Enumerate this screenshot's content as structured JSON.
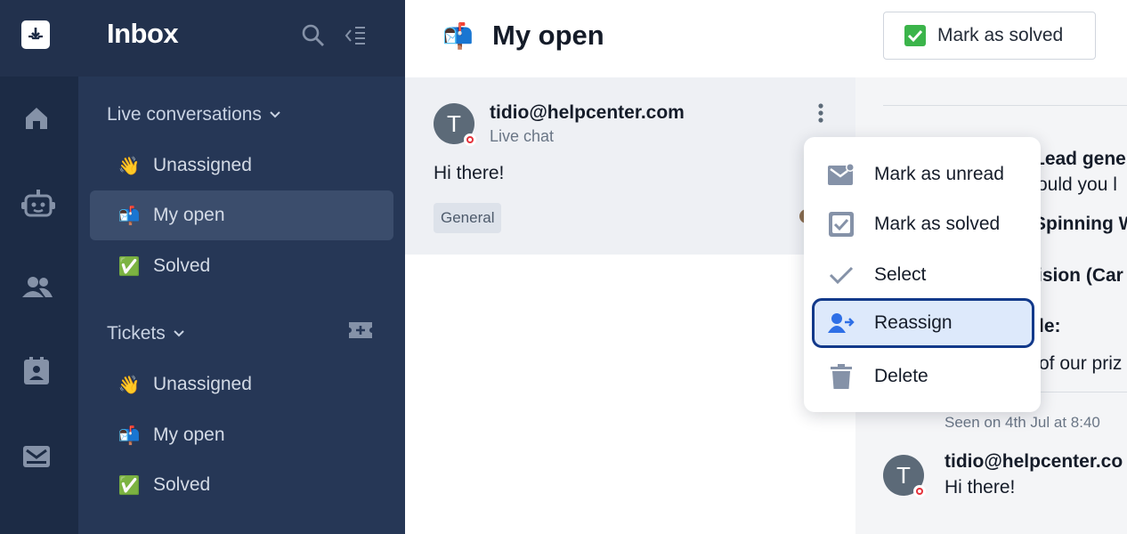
{
  "sidebar": {
    "title": "Inbox",
    "live_section": {
      "label": "Live conversations"
    },
    "live_items": [
      {
        "emoji": "👋",
        "label": "Unassigned"
      },
      {
        "emoji": "📬",
        "label": "My open"
      },
      {
        "emoji": "✅",
        "label": "Solved"
      }
    ],
    "tickets_section": {
      "label": "Tickets"
    },
    "ticket_items": [
      {
        "emoji": "👋",
        "label": "Unassigned"
      },
      {
        "emoji": "📬",
        "label": "My open"
      },
      {
        "emoji": "✅",
        "label": "Solved"
      }
    ]
  },
  "list": {
    "emoji": "📬",
    "title": "My open",
    "conversation": {
      "avatar_letter": "T",
      "email": "tidio@helpcenter.com",
      "channel": "Live chat",
      "preview": "Hi there!",
      "tag": "General"
    }
  },
  "menu": {
    "items": [
      {
        "icon": "mail-unread-icon",
        "label": "Mark as unread"
      },
      {
        "icon": "check-box-icon",
        "label": "Mark as solved"
      },
      {
        "icon": "checkmark-icon",
        "label": "Select"
      },
      {
        "icon": "reassign-user-icon",
        "label": "Reassign"
      },
      {
        "icon": "trash-icon",
        "label": "Delete"
      }
    ]
  },
  "right": {
    "mark_solved_label": "Mark as solved",
    "lines": [
      {
        "text": "Lead gene",
        "bold": true
      },
      {
        "text": "ould you l",
        "bold": false
      },
      {
        "text": "Spinning W",
        "bold": true
      },
      {
        "text": "ision (Car",
        "bold": true
      },
      {
        "text": "le:",
        "bold": true
      },
      {
        "text": "of our priz",
        "bold": false
      }
    ],
    "seen": "Seen on 4th Jul at 8:40 ",
    "avatar_letter": "T",
    "email": "tidio@helpcenter.co",
    "message": "Hi there!"
  },
  "colors": {
    "rail": "#1c2b45",
    "sidebar": "#263756",
    "active_item": "#3b4d6c",
    "highlight_bg": "#dde9fb",
    "highlight_border": "#12398a",
    "status_dot": "#e5323b",
    "solved_green": "#3bb44a"
  }
}
